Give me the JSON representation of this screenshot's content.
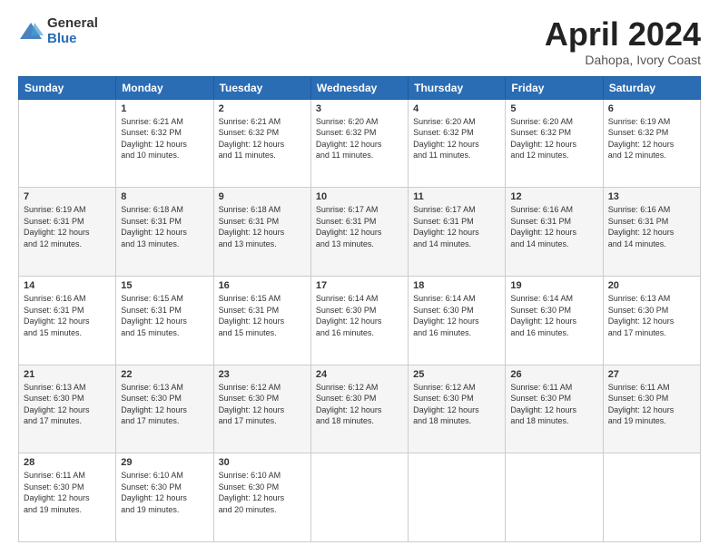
{
  "logo": {
    "general": "General",
    "blue": "Blue"
  },
  "title": "April 2024",
  "subtitle": "Dahopa, Ivory Coast",
  "header_days": [
    "Sunday",
    "Monday",
    "Tuesday",
    "Wednesday",
    "Thursday",
    "Friday",
    "Saturday"
  ],
  "weeks": [
    [
      {
        "day": null
      },
      {
        "day": "1",
        "sunrise": "6:21 AM",
        "sunset": "6:32 PM",
        "daylight": "12 hours and 10 minutes."
      },
      {
        "day": "2",
        "sunrise": "6:21 AM",
        "sunset": "6:32 PM",
        "daylight": "12 hours and 11 minutes."
      },
      {
        "day": "3",
        "sunrise": "6:20 AM",
        "sunset": "6:32 PM",
        "daylight": "12 hours and 11 minutes."
      },
      {
        "day": "4",
        "sunrise": "6:20 AM",
        "sunset": "6:32 PM",
        "daylight": "12 hours and 11 minutes."
      },
      {
        "day": "5",
        "sunrise": "6:20 AM",
        "sunset": "6:32 PM",
        "daylight": "12 hours and 12 minutes."
      },
      {
        "day": "6",
        "sunrise": "6:19 AM",
        "sunset": "6:32 PM",
        "daylight": "12 hours and 12 minutes."
      }
    ],
    [
      {
        "day": "7",
        "sunrise": "6:19 AM",
        "sunset": "6:31 PM",
        "daylight": "12 hours and 12 minutes."
      },
      {
        "day": "8",
        "sunrise": "6:18 AM",
        "sunset": "6:31 PM",
        "daylight": "12 hours and 13 minutes."
      },
      {
        "day": "9",
        "sunrise": "6:18 AM",
        "sunset": "6:31 PM",
        "daylight": "12 hours and 13 minutes."
      },
      {
        "day": "10",
        "sunrise": "6:17 AM",
        "sunset": "6:31 PM",
        "daylight": "12 hours and 13 minutes."
      },
      {
        "day": "11",
        "sunrise": "6:17 AM",
        "sunset": "6:31 PM",
        "daylight": "12 hours and 14 minutes."
      },
      {
        "day": "12",
        "sunrise": "6:16 AM",
        "sunset": "6:31 PM",
        "daylight": "12 hours and 14 minutes."
      },
      {
        "day": "13",
        "sunrise": "6:16 AM",
        "sunset": "6:31 PM",
        "daylight": "12 hours and 14 minutes."
      }
    ],
    [
      {
        "day": "14",
        "sunrise": "6:16 AM",
        "sunset": "6:31 PM",
        "daylight": "12 hours and 15 minutes."
      },
      {
        "day": "15",
        "sunrise": "6:15 AM",
        "sunset": "6:31 PM",
        "daylight": "12 hours and 15 minutes."
      },
      {
        "day": "16",
        "sunrise": "6:15 AM",
        "sunset": "6:31 PM",
        "daylight": "12 hours and 15 minutes."
      },
      {
        "day": "17",
        "sunrise": "6:14 AM",
        "sunset": "6:30 PM",
        "daylight": "12 hours and 16 minutes."
      },
      {
        "day": "18",
        "sunrise": "6:14 AM",
        "sunset": "6:30 PM",
        "daylight": "12 hours and 16 minutes."
      },
      {
        "day": "19",
        "sunrise": "6:14 AM",
        "sunset": "6:30 PM",
        "daylight": "12 hours and 16 minutes."
      },
      {
        "day": "20",
        "sunrise": "6:13 AM",
        "sunset": "6:30 PM",
        "daylight": "12 hours and 17 minutes."
      }
    ],
    [
      {
        "day": "21",
        "sunrise": "6:13 AM",
        "sunset": "6:30 PM",
        "daylight": "12 hours and 17 minutes."
      },
      {
        "day": "22",
        "sunrise": "6:13 AM",
        "sunset": "6:30 PM",
        "daylight": "12 hours and 17 minutes."
      },
      {
        "day": "23",
        "sunrise": "6:12 AM",
        "sunset": "6:30 PM",
        "daylight": "12 hours and 17 minutes."
      },
      {
        "day": "24",
        "sunrise": "6:12 AM",
        "sunset": "6:30 PM",
        "daylight": "12 hours and 18 minutes."
      },
      {
        "day": "25",
        "sunrise": "6:12 AM",
        "sunset": "6:30 PM",
        "daylight": "12 hours and 18 minutes."
      },
      {
        "day": "26",
        "sunrise": "6:11 AM",
        "sunset": "6:30 PM",
        "daylight": "12 hours and 18 minutes."
      },
      {
        "day": "27",
        "sunrise": "6:11 AM",
        "sunset": "6:30 PM",
        "daylight": "12 hours and 19 minutes."
      }
    ],
    [
      {
        "day": "28",
        "sunrise": "6:11 AM",
        "sunset": "6:30 PM",
        "daylight": "12 hours and 19 minutes."
      },
      {
        "day": "29",
        "sunrise": "6:10 AM",
        "sunset": "6:30 PM",
        "daylight": "12 hours and 19 minutes."
      },
      {
        "day": "30",
        "sunrise": "6:10 AM",
        "sunset": "6:30 PM",
        "daylight": "12 hours and 20 minutes."
      },
      {
        "day": null
      },
      {
        "day": null
      },
      {
        "day": null
      },
      {
        "day": null
      }
    ]
  ]
}
